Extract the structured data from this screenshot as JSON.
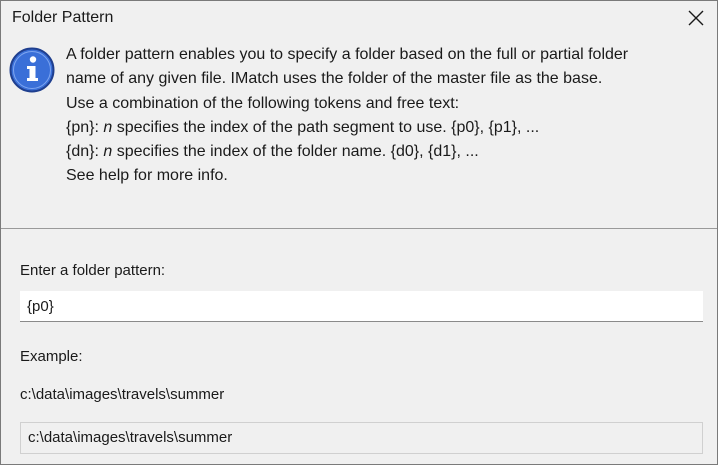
{
  "window": {
    "title": "Folder Pattern"
  },
  "info": {
    "icon": "info-icon",
    "line1": "A folder pattern enables you to specify a folder based on the full or partial folder",
    "line2": "name of any given file. IMatch uses the folder of the master file as the base.",
    "line3": "Use a combination of the following tokens and free text:",
    "line4_token": "{pn}: ",
    "line4_var": "n",
    "line4_rest": " specifies the index of the path segment to use. {p0}, {p1}, ...",
    "line5_token": "{dn}: ",
    "line5_var": "n",
    "line5_rest": " specifies the index of the folder name. {d0}, {d1}, ...",
    "line6": "See help for more info."
  },
  "form": {
    "pattern_label": "Enter a folder pattern:",
    "pattern_value": "{p0}",
    "example_label": "Example:",
    "example_path": "c:\\data\\images\\travels\\summer",
    "result_value": "c:\\data\\images\\travels\\summer"
  },
  "colors": {
    "info_icon_fill": "#3a6fd8",
    "info_icon_border": "#1f3f8f"
  }
}
